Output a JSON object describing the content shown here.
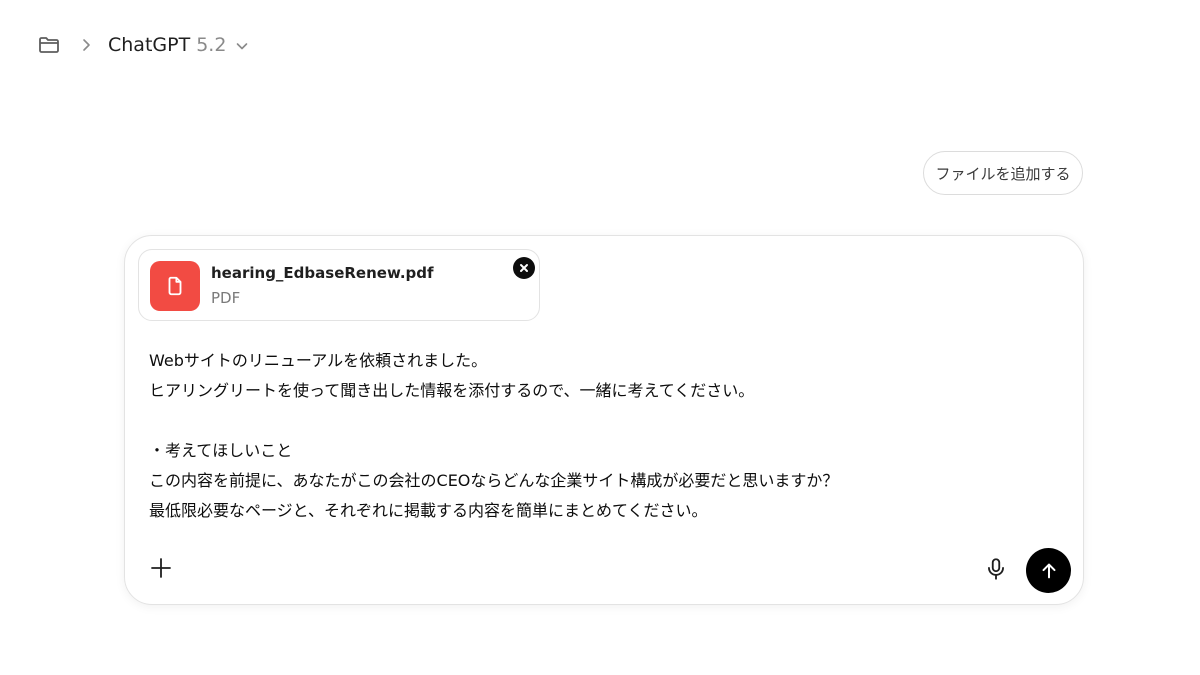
{
  "header": {
    "model_name": "ChatGPT",
    "model_version": "5.2"
  },
  "toolbar": {
    "add_file_label": "ファイルを追加する"
  },
  "composer": {
    "attachment": {
      "file_name": "hearing_EdbaseRenew.pdf",
      "file_type": "PDF"
    },
    "message_lines": [
      "Webサイトのリニューアルを依頼されました。",
      "ヒアリングリートを使って聞き出した情報を添付するので、一緒に考えてください。",
      "",
      "・考えてほしいこと",
      "この内容を前提に、あなたがこの会社のCEOならどんな企業サイト構成が必要だと思いますか？",
      "最低限必要なページと、それぞれに掲載する内容を簡単にまとめてください。"
    ]
  },
  "icons": {
    "folder": "folder-icon",
    "separator": "chevron-right-icon",
    "model_menu": "chevron-down-icon",
    "attachment": "document-icon",
    "remove": "close-icon",
    "plus": "plus-icon",
    "mic": "microphone-icon",
    "send": "arrow-up-icon"
  },
  "colors": {
    "pdf_badge": "#f24b43",
    "send_button": "#000000",
    "model_version": "#8a8a8a"
  }
}
